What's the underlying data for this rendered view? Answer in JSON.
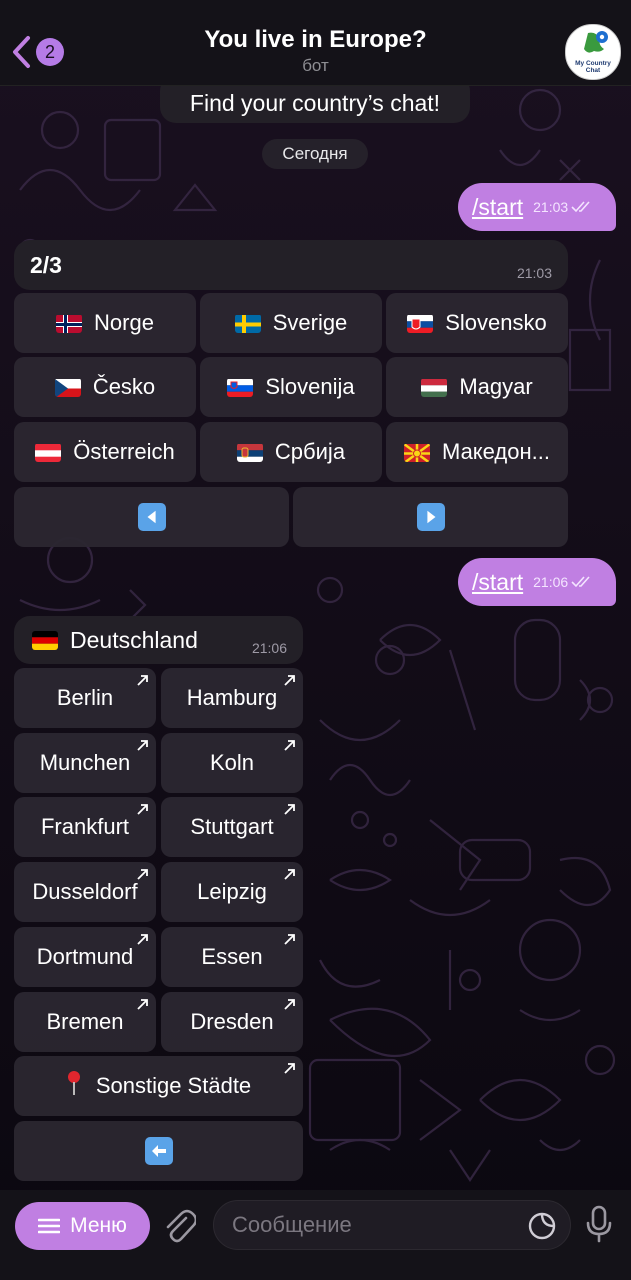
{
  "header": {
    "back_badge": "2",
    "title": "You live in Europe?",
    "subtitle": "бот",
    "avatar_text": "My Country Chat"
  },
  "chat": {
    "partial_message": "Find your country’s chat!",
    "date_label": "Сегодня",
    "outgoing": [
      {
        "text": "/start",
        "time": "21:03"
      },
      {
        "text": "/start",
        "time": "21:06"
      }
    ],
    "page_message": {
      "text": "2/3",
      "time": "21:03"
    },
    "country_buttons": [
      {
        "label": "Norge",
        "flag": "flag-norway"
      },
      {
        "label": "Sverige",
        "flag": "flag-sweden"
      },
      {
        "label": "Slovensko",
        "flag": "flag-slovakia"
      },
      {
        "label": "Česko",
        "flag": "flag-czechia"
      },
      {
        "label": "Slovenija",
        "flag": "flag-slovenia"
      },
      {
        "label": "Magyar",
        "flag": "flag-hungary"
      },
      {
        "label": "Österreich",
        "flag": "flag-austria"
      },
      {
        "label": "Србија",
        "flag": "flag-serbia"
      },
      {
        "label": "Македон...",
        "flag": "flag-north-macedonia"
      }
    ],
    "pager": {
      "prev_icon": "left-arrow-icon",
      "next_icon": "right-arrow-icon"
    },
    "country_message": {
      "text": "Deutschland",
      "flag": "flag-germany",
      "time": "21:06"
    },
    "city_buttons": [
      "Berlin",
      "Hamburg",
      "Munchen",
      "Koln",
      "Frankfurt",
      "Stuttgart",
      "Dusseldorf",
      "Leipzig",
      "Dortmund",
      "Essen",
      "Bremen",
      "Dresden"
    ],
    "other_cities": "Sonstige Städte",
    "back_icon": "back-arrow-icon"
  },
  "composer": {
    "menu_label": "Меню",
    "placeholder": "Сообщение"
  },
  "colors": {
    "accent": "#c07fe2",
    "bubble": "#232027",
    "background": "#0b0810"
  }
}
